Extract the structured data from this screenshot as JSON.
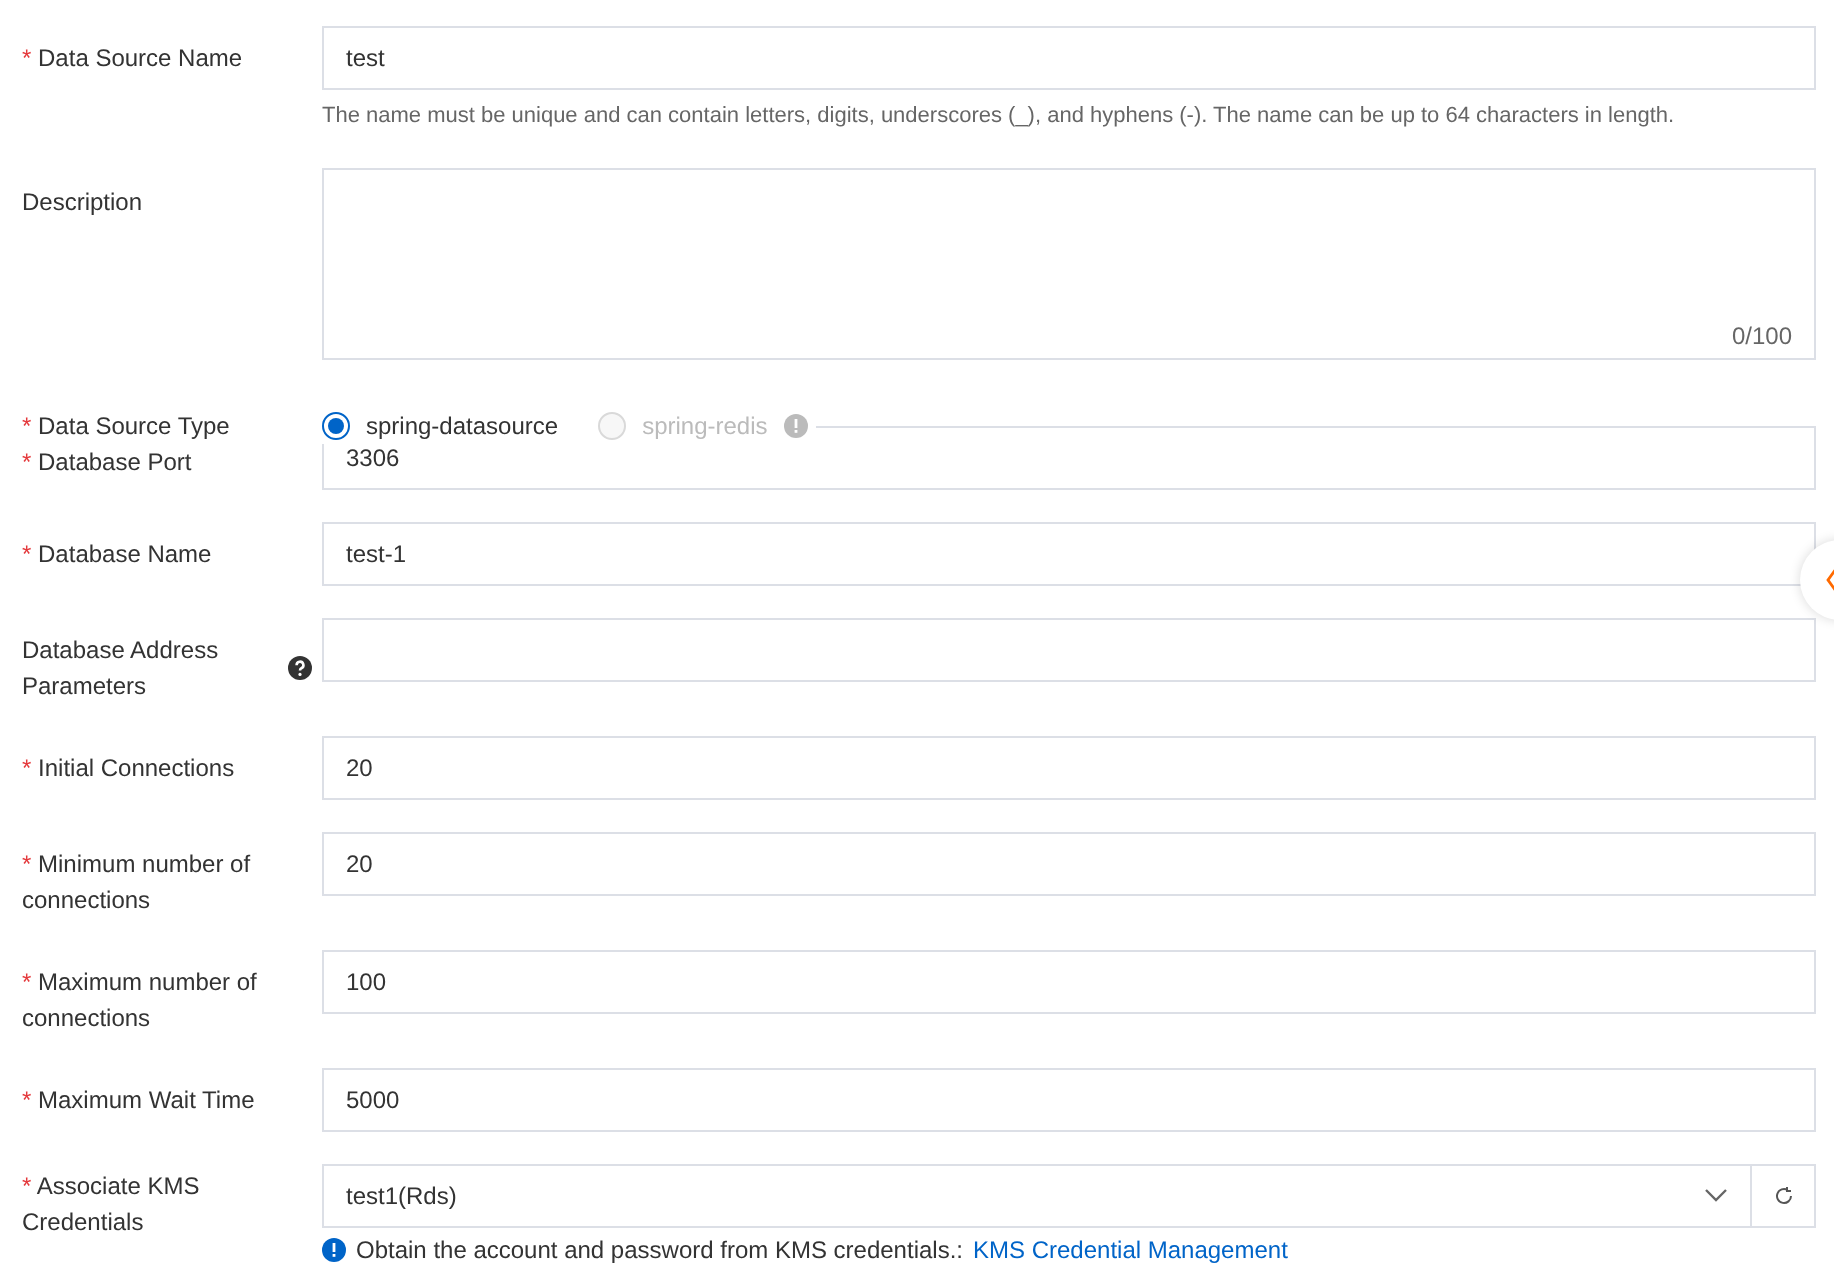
{
  "fields": [
    {
      "kind": "input",
      "label": "Data Source Name",
      "mark": "*",
      "value": "test",
      "hint": "The name must be unique and can contain letters, digits, underscores (_), and hyphens (-). The name can be up to 64 characters in length."
    },
    {
      "kind": "textarea",
      "label": "Description",
      "counter": "0/100"
    },
    {
      "kind": "radio",
      "label": "Data Source Type",
      "mark": "*",
      "options": [
        {
          "label": "spring-datasource",
          "selected": true,
          "disabled": false
        },
        {
          "label": "spring-redis",
          "selected": false,
          "disabled": true,
          "info": true
        }
      ]
    },
    {
      "kind": "input",
      "label": "Database Port",
      "mark": "*",
      "value": "3306",
      "overlapped": true
    },
    {
      "kind": "input",
      "label": "Database Name",
      "mark": "*",
      "value": "test-1"
    },
    {
      "kind": "input",
      "label": "Database Address Parameters",
      "help": true
    },
    {
      "kind": "input",
      "label": "Initial Connections",
      "mark": "*",
      "value": "20"
    },
    {
      "kind": "input",
      "label": "Minimum number of connections",
      "mark": "*",
      "value": "20"
    },
    {
      "kind": "input",
      "label": "Maximum number of connections",
      "mark": "*",
      "value": "100"
    },
    {
      "kind": "input",
      "label": "Maximum Wait Time",
      "mark": "*",
      "value": "5000"
    },
    {
      "kind": "select",
      "label": "Associate KMS Credentials",
      "mark": "*",
      "value": "test1(Rds)",
      "hint": "Obtain the account and password from KMS credentials.:",
      "link": "KMS Credential Management"
    }
  ]
}
